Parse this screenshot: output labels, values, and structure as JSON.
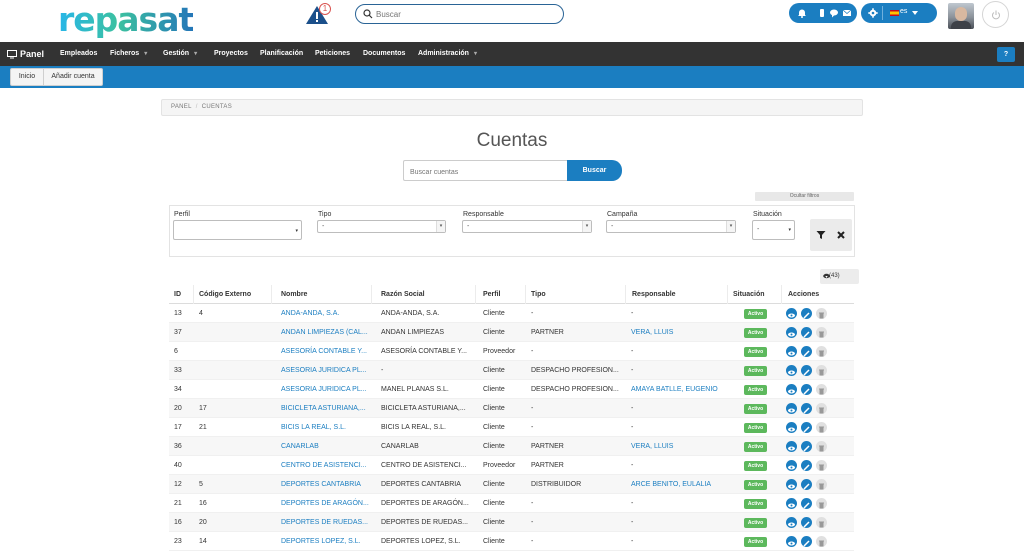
{
  "brand": {
    "logo_text": "repasat"
  },
  "header": {
    "alert_count": "1",
    "search_placeholder": "Buscar",
    "language": "es"
  },
  "nav": {
    "panel": "Panel",
    "items": [
      "Empleados",
      "Ficheros",
      "Gestión",
      "Proyectos",
      "Planificación",
      "Peticiones",
      "Documentos",
      "Administración"
    ],
    "help": "?"
  },
  "subbar": {
    "btn_inicio": "Inicio",
    "btn_add": "Añadir cuenta"
  },
  "breadcrumb": {
    "root": "PANEL",
    "sep": "/",
    "current": "CUENTAS"
  },
  "page": {
    "title": "Cuentas",
    "search_placeholder": "Buscar cuentas",
    "search_button": "Buscar",
    "hide_filters": "Ocultar filtros"
  },
  "filters": {
    "perfil_label": "Perfil",
    "perfil_value": "",
    "tipo_label": "Tipo",
    "tipo_value": "-",
    "responsable_label": "Responsable",
    "responsable_value": "-",
    "campana_label": "Campaña",
    "campana_value": "-",
    "situacion_label": "Situación",
    "situacion_value": "-"
  },
  "export": {
    "count": "(43)"
  },
  "table": {
    "columns": [
      "ID",
      "Código Externo",
      "Nombre",
      "Razón Social",
      "Perfil",
      "Tipo",
      "Responsable",
      "Situación",
      "Acciones"
    ],
    "rows": [
      {
        "id": "13",
        "code": "4",
        "name": "ANDA-ANDA, S.A.",
        "razon": "ANDA-ANDA, S.A.",
        "perfil": "Cliente",
        "tipo": "-",
        "resp": "-",
        "sit": "Activo"
      },
      {
        "id": "37",
        "code": "",
        "name": "ANDAN LIMPIEZAS (CAL...",
        "razon": "ANDAN LIMPIEZAS",
        "perfil": "Cliente",
        "tipo": "PARTNER",
        "resp": "VERA, LLUIS",
        "sit": "Activo"
      },
      {
        "id": "6",
        "code": "",
        "name": "ASESORÍA CONTABLE Y...",
        "razon": "ASESORÍA CONTABLE Y...",
        "perfil": "Proveedor",
        "tipo": "-",
        "resp": "-",
        "sit": "Activo"
      },
      {
        "id": "33",
        "code": "",
        "name": "ASESORIA JURIDICA PL...",
        "razon": "-",
        "perfil": "Cliente",
        "tipo": "DESPACHO PROFESION...",
        "resp": "-",
        "sit": "Activo"
      },
      {
        "id": "34",
        "code": "",
        "name": "ASESORIA JURIDICA PL...",
        "razon": "MANEL PLANAS S.L.",
        "perfil": "Cliente",
        "tipo": "DESPACHO PROFESION...",
        "resp": "AMAYA BATLLE, EUGENIO",
        "sit": "Activo"
      },
      {
        "id": "20",
        "code": "17",
        "name": "BICICLETA ASTURIANA,...",
        "razon": "BICICLETA ASTURIANA,...",
        "perfil": "Cliente",
        "tipo": "-",
        "resp": "-",
        "sit": "Activo"
      },
      {
        "id": "17",
        "code": "21",
        "name": "BICIS LA REAL, S.L.",
        "razon": "BICIS LA REAL, S.L.",
        "perfil": "Cliente",
        "tipo": "-",
        "resp": "-",
        "sit": "Activo"
      },
      {
        "id": "36",
        "code": "",
        "name": "CANARLAB",
        "razon": "CANARLAB",
        "perfil": "Cliente",
        "tipo": "PARTNER",
        "resp": "VERA, LLUIS",
        "sit": "Activo"
      },
      {
        "id": "40",
        "code": "",
        "name": "CENTRO DE ASISTENCI...",
        "razon": "CENTRO DE ASISTENCI...",
        "perfil": "Proveedor",
        "tipo": "PARTNER",
        "resp": "-",
        "sit": "Activo"
      },
      {
        "id": "12",
        "code": "5",
        "name": "DEPORTES CANTABRIA",
        "razon": "DEPORTES CANTABRIA",
        "perfil": "Cliente",
        "tipo": "DISTRIBUIDOR",
        "resp": "ARCE BENITO, EULALIA",
        "sit": "Activo"
      },
      {
        "id": "21",
        "code": "16",
        "name": "DEPORTES DE ARAGÓN...",
        "razon": "DEPORTES DE ARAGÓN...",
        "perfil": "Cliente",
        "tipo": "-",
        "resp": "-",
        "sit": "Activo"
      },
      {
        "id": "16",
        "code": "20",
        "name": "DEPORTES DE RUEDAS...",
        "razon": "DEPORTES DE RUEDAS...",
        "perfil": "Cliente",
        "tipo": "-",
        "resp": "-",
        "sit": "Activo"
      },
      {
        "id": "23",
        "code": "14",
        "name": "DEPORTES LOPEZ, S.L.",
        "razon": "DEPORTES LOPEZ, S.L.",
        "perfil": "Cliente",
        "tipo": "-",
        "resp": "-",
        "sit": "Activo"
      }
    ]
  },
  "colors": {
    "primary": "#1b7ec1",
    "nav_bg": "#333333",
    "active_badge": "#5cb85c"
  }
}
